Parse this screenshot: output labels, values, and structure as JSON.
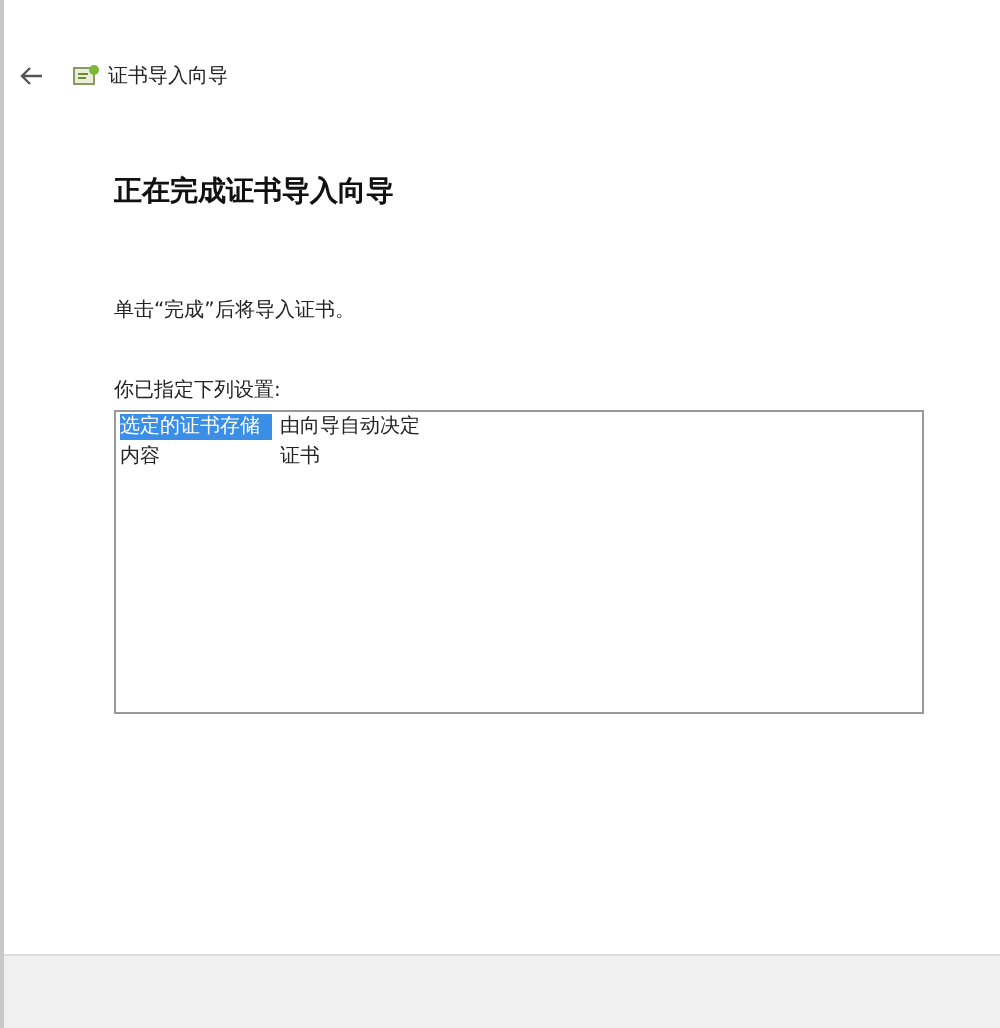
{
  "window": {
    "title": "证书导入向导"
  },
  "heading": "正在完成证书导入向导",
  "instruction": "单击“完成”后将导入证书。",
  "settings_label": "你已指定下列设置:",
  "settings": [
    {
      "name": "选定的证书存储",
      "value": "由向导自动决定",
      "selected": true
    },
    {
      "name": "内容",
      "value": "证书",
      "selected": false
    }
  ]
}
